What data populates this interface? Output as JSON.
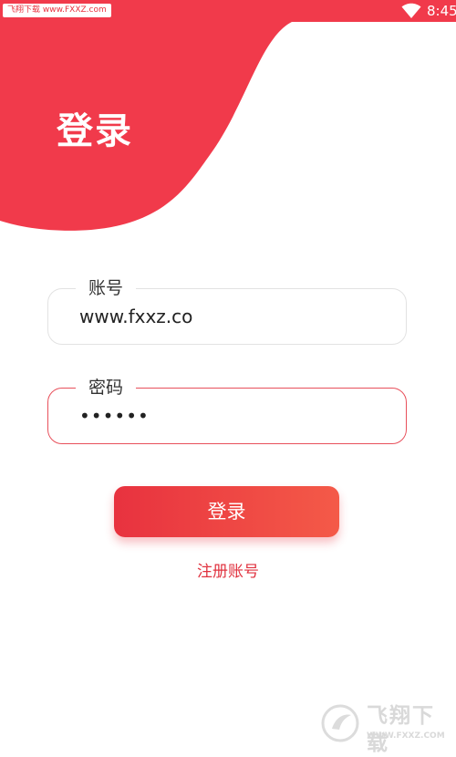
{
  "theme": {
    "accent": "#e8323f",
    "accent_light": "#f45a48",
    "text": "#333333",
    "field_border": "#e2e2e2",
    "field_border_focus": "#e8505b"
  },
  "status_bar": {
    "watermark": "飞翔下载 www.FXXZ.com",
    "time": "8:45",
    "wifi_icon": "wifi-icon"
  },
  "header": {
    "title": "登录"
  },
  "form": {
    "account": {
      "label": "账号",
      "value": "www.fxxz.co"
    },
    "password": {
      "label": "密码",
      "value": "••••••"
    },
    "login_button": "登录",
    "register_link": "注册账号"
  },
  "watermark_logo": {
    "title": "飞翔下载",
    "url": "WWW.FXXZ.COM"
  }
}
